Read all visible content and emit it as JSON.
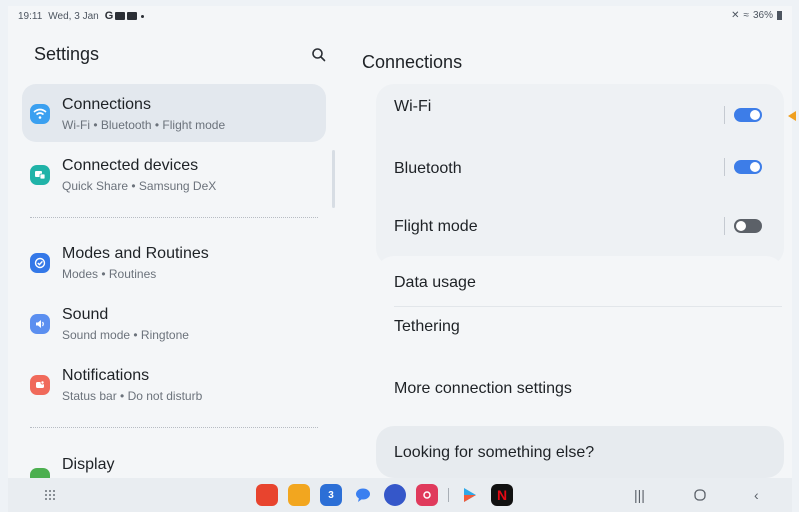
{
  "status_bar": {
    "time": "19:11",
    "date": "Wed, 3 Jan",
    "notif_letter": "G",
    "battery": "36%"
  },
  "settings_pane": {
    "title": "Settings",
    "items": [
      {
        "title": "Connections",
        "subtitle": "Wi-Fi  •  Bluetooth  •  Flight mode",
        "icon": "wifi-icon",
        "color": "#3ba0f0"
      },
      {
        "title": "Connected devices",
        "subtitle": "Quick Share  •  Samsung DeX",
        "icon": "connected-devices-icon",
        "color": "#20b3a8"
      },
      {
        "title": "Modes and Routines",
        "subtitle": "Modes  •  Routines",
        "icon": "check-circle-icon",
        "color": "#3478e8"
      },
      {
        "title": "Sound",
        "subtitle": "Sound mode  •  Ringtone",
        "icon": "speaker-icon",
        "color": "#5b8ff0"
      },
      {
        "title": "Notifications",
        "subtitle": "Status bar  •  Do not disturb",
        "icon": "bell-icon",
        "color": "#f06a5b"
      },
      {
        "title": "Display",
        "subtitle": "",
        "icon": "display-icon",
        "color": "#4caf50"
      }
    ]
  },
  "connections_pane": {
    "title": "Connections",
    "wifi": {
      "label": "Wi-Fi",
      "enabled": true
    },
    "bluetooth": {
      "label": "Bluetooth",
      "enabled": true
    },
    "flight_mode": {
      "label": "Flight mode",
      "enabled": false
    },
    "data_usage": "Data usage",
    "tethering": "Tethering",
    "more_settings": "More connection settings",
    "looking": "Looking for something else?"
  },
  "colors": {
    "accent": "#3d7de8",
    "pointer": "#f0a020"
  },
  "dock": {
    "apps": [
      {
        "name": "app-red-icon",
        "color": "#e8442e",
        "label": ""
      },
      {
        "name": "folder-icon",
        "color": "#f2a61f",
        "label": ""
      },
      {
        "name": "calendar-icon",
        "color": "#2c6fd6",
        "label": "3"
      },
      {
        "name": "messages-icon",
        "color": "#3a7ff0",
        "label": ""
      },
      {
        "name": "browser-icon",
        "color": "#3557c9",
        "label": ""
      },
      {
        "name": "camera-icon",
        "color": "#e03a5c",
        "label": ""
      },
      {
        "name": "play-store-icon",
        "color": "#ffffff",
        "label": ""
      },
      {
        "name": "netflix-icon",
        "color": "#111111",
        "label": "N"
      }
    ]
  }
}
